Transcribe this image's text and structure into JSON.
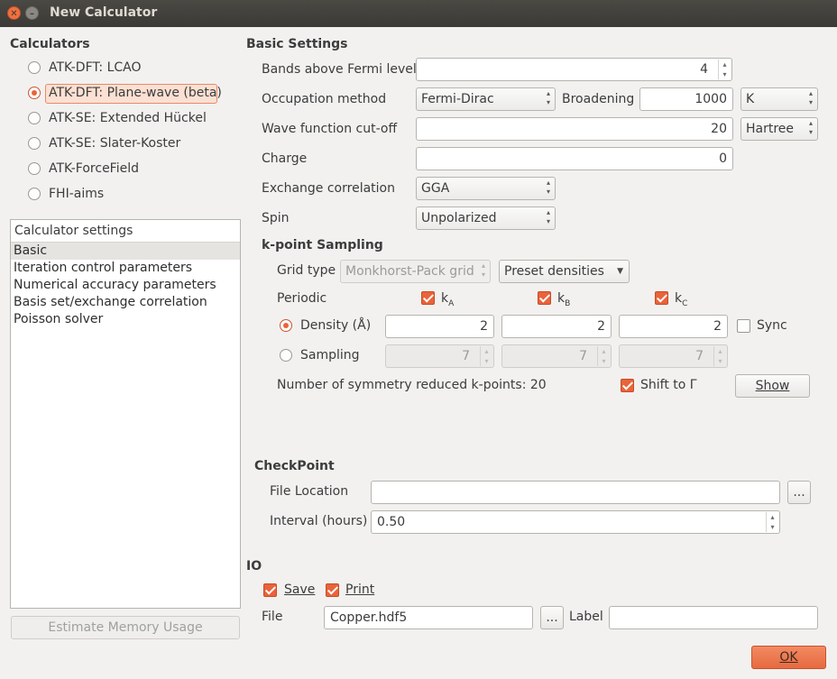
{
  "window": {
    "title": "New Calculator"
  },
  "calculators": {
    "heading": "Calculators",
    "options": [
      {
        "label": "ATK-DFT: LCAO",
        "selected": false
      },
      {
        "label": "ATK-DFT: Plane-wave (beta)",
        "selected": true
      },
      {
        "label": "ATK-SE: Extended Hückel",
        "selected": false
      },
      {
        "label": "ATK-SE: Slater-Koster",
        "selected": false
      },
      {
        "label": "ATK-ForceField",
        "selected": false
      },
      {
        "label": "FHI-aims",
        "selected": false
      }
    ]
  },
  "settings_list": {
    "header": "Calculator settings",
    "items": [
      "Basic",
      "Iteration control parameters",
      "Numerical accuracy parameters",
      "Basis set/exchange correlation",
      "Poisson solver"
    ],
    "selected_index": 0
  },
  "estimate_button": "Estimate Memory Usage",
  "basic": {
    "heading": "Basic Settings",
    "bands_label": "Bands above Fermi level",
    "bands_value": "4",
    "occupation_label": "Occupation method",
    "occupation_value": "Fermi-Dirac",
    "broadening_label": "Broadening",
    "broadening_value": "1000",
    "broadening_unit": "K",
    "cutoff_label": "Wave function cut-off",
    "cutoff_value": "20",
    "cutoff_unit": "Hartree",
    "charge_label": "Charge",
    "charge_value": "0",
    "xc_label": "Exchange correlation",
    "xc_value": "GGA",
    "spin_label": "Spin",
    "spin_value": "Unpolarized"
  },
  "kpoint": {
    "heading": "k-point Sampling",
    "grid_type_label": "Grid type",
    "grid_type_value": "Monkhorst-Pack grid",
    "preset_value": "Preset densities",
    "periodic_label": "Periodic",
    "k_labels": [
      "k",
      "k",
      "k"
    ],
    "k_subs": [
      "A",
      "B",
      "C"
    ],
    "density_label": "Density (Å)",
    "density_values": [
      "2",
      "2",
      "2"
    ],
    "sync_label": "Sync",
    "sampling_label": "Sampling",
    "sampling_values": [
      "7",
      "7",
      "7"
    ],
    "symmetry_text": "Number of symmetry reduced k-points: 20",
    "shift_label": "Shift to Γ",
    "show_button": "Show"
  },
  "checkpoint": {
    "heading": "CheckPoint",
    "file_label": "File Location",
    "file_value": "",
    "browse": "...",
    "interval_label": "Interval (hours)",
    "interval_value": "0.50"
  },
  "io": {
    "heading": "IO",
    "save_label": "Save",
    "print_label": "Print",
    "file_label": "File",
    "file_value": "Copper.hdf5",
    "browse": "...",
    "label_label": "Label",
    "label_value": ""
  },
  "ok_button": "OK",
  "colors": {
    "accent": "#e9633b",
    "titlebar": "#3b3a36",
    "background": "#f2f1f0"
  }
}
